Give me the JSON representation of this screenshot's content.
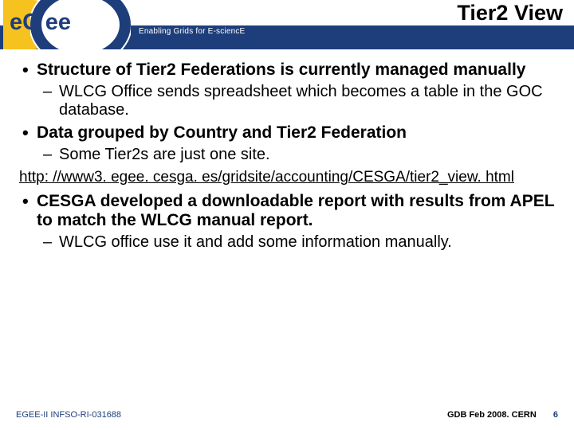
{
  "header": {
    "title": "Tier2 View",
    "tagline": "Enabling Grids for E-sciencE",
    "logo_text": "eGee"
  },
  "body": {
    "bullets": [
      {
        "text": "Structure of Tier2 Federations is currently managed manually",
        "sub": [
          "WLCG Office sends spreadsheet which becomes a table in the GOC database."
        ]
      },
      {
        "text": "Data grouped by Country and Tier2 Federation",
        "sub": [
          "Some Tier2s are just one site."
        ]
      }
    ],
    "link": "http: //www3. egee. cesga. es/gridsite/accounting/CESGA/tier2_view. html",
    "bullets2": [
      {
        "text": "CESGA developed a downloadable report with results from APEL to match the WLCG manual report.",
        "sub": [
          "WLCG office use it and add some information manually."
        ]
      }
    ]
  },
  "footer": {
    "left": "EGEE-II INFSO-RI-031688",
    "right": "GDB Feb 2008. CERN",
    "page": "6"
  }
}
